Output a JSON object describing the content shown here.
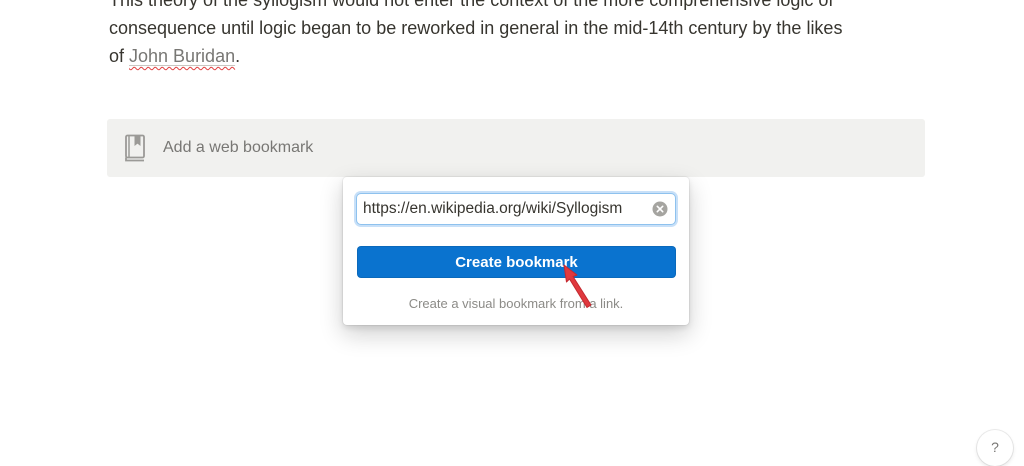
{
  "paragraph": {
    "line1": "This theory of the syllogism would not enter the context of the more comprehensive logic of",
    "line2": "consequence until logic began to be reworked in general in the mid-14th century by the likes",
    "line3_prefix": "of ",
    "link_text": "John Buridan",
    "line3_suffix": "."
  },
  "bookmark_block": {
    "icon": "bookmark-book-icon",
    "placeholder": "Add a web bookmark"
  },
  "popover": {
    "url_value": "https://en.wikipedia.org/wiki/Syllogism",
    "clear_icon": "clear-circle-x-icon",
    "button_label": "Create bookmark",
    "hint": "Create a visual bookmark from a link."
  },
  "help": {
    "label": "?"
  },
  "colors": {
    "button": "#0a73cf",
    "block_bg": "#f1f1ef",
    "text": "#37352f",
    "muted": "#787774",
    "cursor_arrow": "#e0393e"
  }
}
